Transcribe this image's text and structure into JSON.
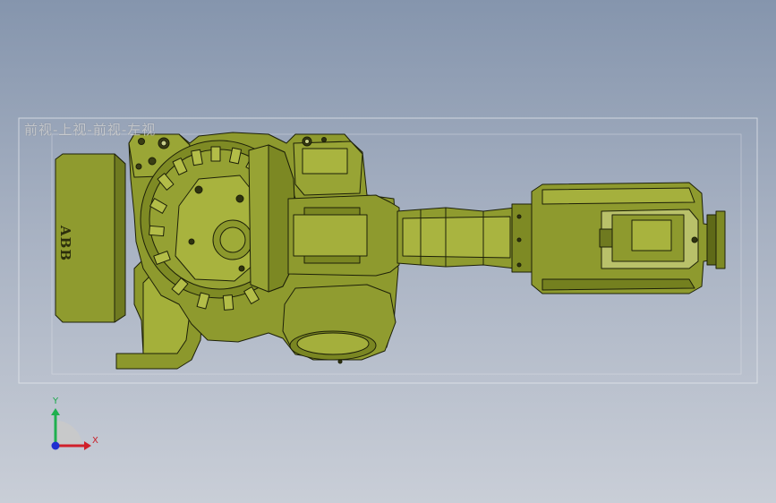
{
  "viewport": {
    "view_label": "前视-上视-前视-左视",
    "background_top": "#8595ad",
    "background_bottom": "#c9ced7"
  },
  "model": {
    "brand": "ABB",
    "body_color": "#8e9a2e",
    "edge_color": "#1d2008"
  },
  "triad": {
    "x_label": "X",
    "y_label": "Y",
    "x_color": "#d0202a",
    "y_color": "#1fb04f",
    "z_color": "#2030d0",
    "icon": "coordinate-triad-icon"
  }
}
